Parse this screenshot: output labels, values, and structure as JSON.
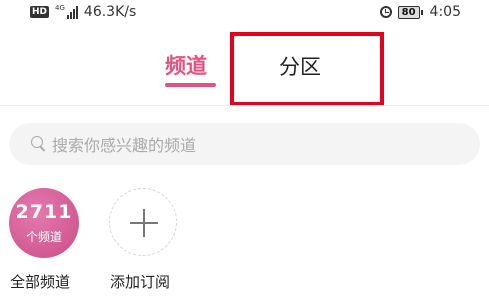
{
  "status_bar": {
    "hd": "HD",
    "network": "4G",
    "speed": "46.3K/s",
    "battery": "80",
    "time": "4:05"
  },
  "tabs": [
    {
      "label": "频道",
      "active": true
    },
    {
      "label": "分区",
      "active": false
    }
  ],
  "colors": {
    "accent": "#e2537f",
    "highlight_box": "#e2001a"
  },
  "search": {
    "placeholder": "搜索你感兴趣的频道"
  },
  "channels": {
    "all": {
      "count": "2711",
      "sub": "个频道",
      "label": "全部频道"
    },
    "add": {
      "label": "添加订阅"
    }
  }
}
